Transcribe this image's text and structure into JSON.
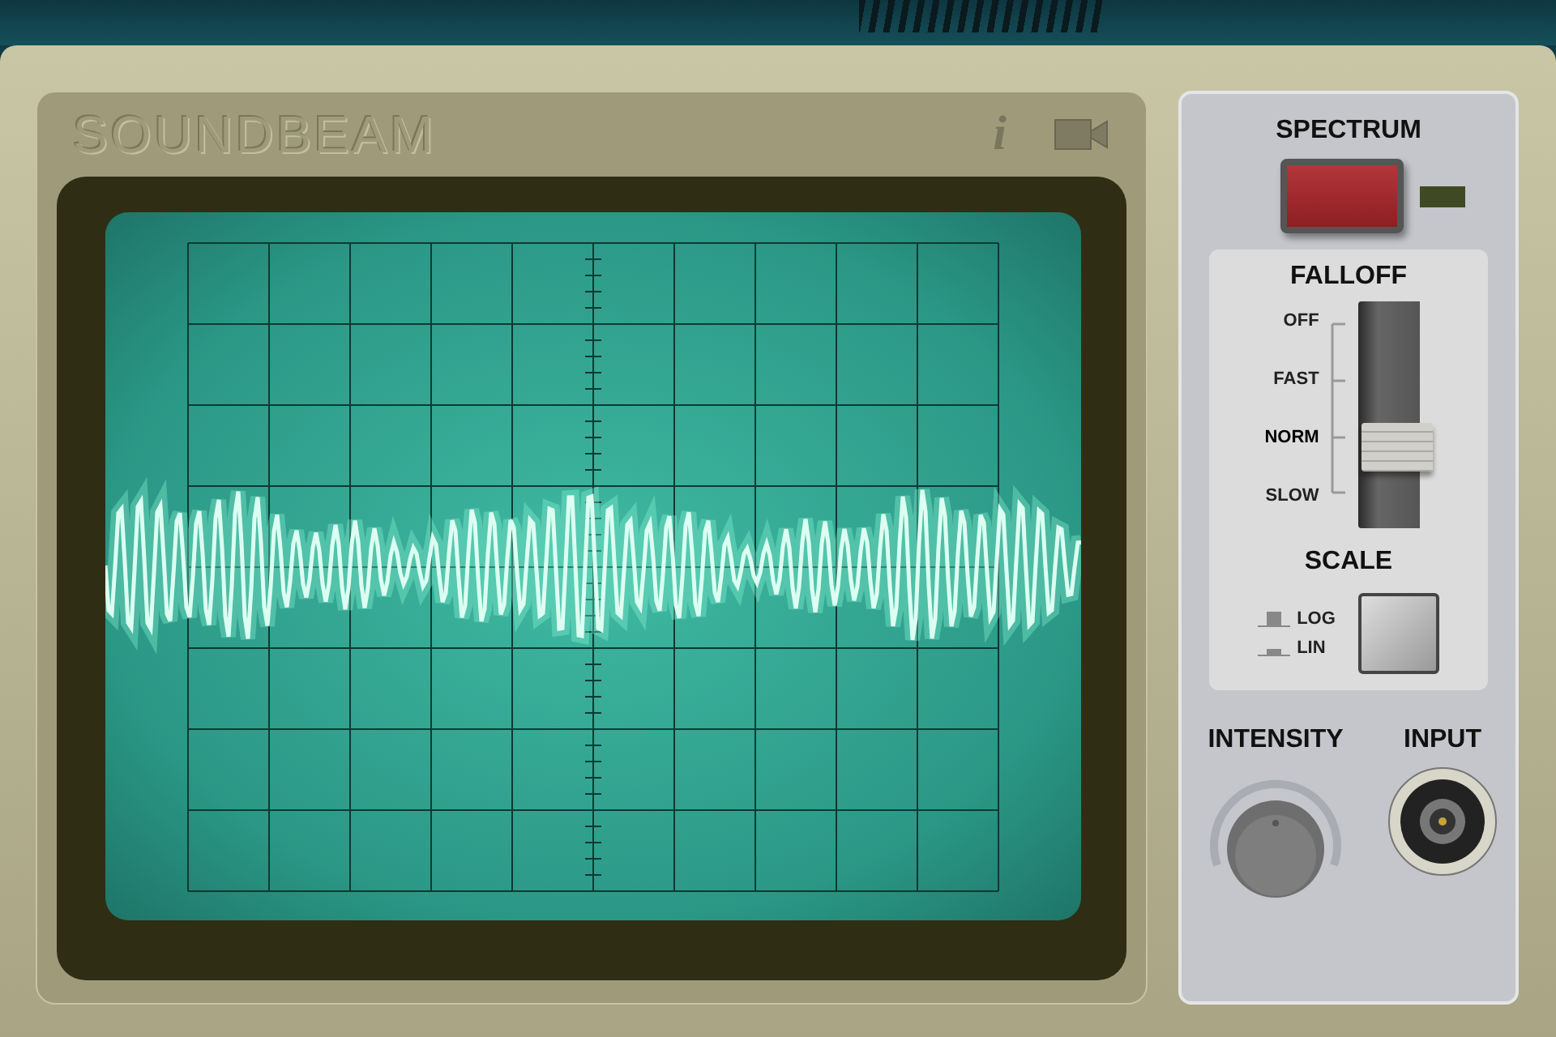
{
  "brand": "SOUNDBEAM",
  "info_button": "i",
  "spectrum": {
    "label": "SPECTRUM",
    "on": false
  },
  "falloff": {
    "label": "FALLOFF",
    "options": [
      {
        "label": "OFF",
        "selected": false
      },
      {
        "label": "FAST",
        "selected": false
      },
      {
        "label": "NORM",
        "selected": true
      },
      {
        "label": "SLOW",
        "selected": false
      }
    ]
  },
  "scale": {
    "label": "SCALE",
    "pressed": false,
    "options": [
      {
        "label": "LOG",
        "kind": "tall"
      },
      {
        "label": "LIN",
        "kind": "flat"
      }
    ]
  },
  "intensity": {
    "label": "INTENSITY"
  },
  "input": {
    "label": "INPUT"
  }
}
